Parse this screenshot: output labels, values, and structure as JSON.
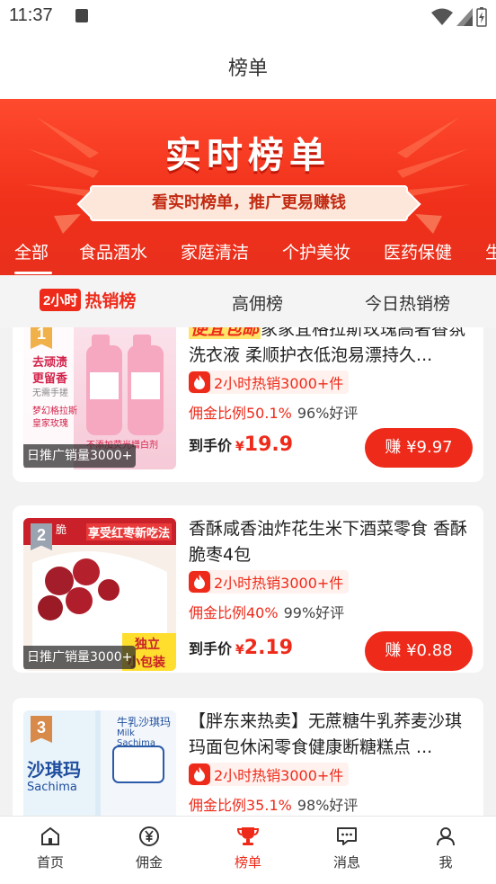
{
  "status_bar": {
    "time": "11:37"
  },
  "header": {
    "title": "榜单"
  },
  "banner": {
    "title": "实时榜单",
    "subtitle": "看实时榜单，推广更易赚钱"
  },
  "category_tabs": [
    "全部",
    "食品酒水",
    "家庭清洁",
    "个护美妆",
    "医药保健",
    "生"
  ],
  "rank_tabs": {
    "active_badge": "2小时",
    "active_label": "热销榜",
    "tab2": "高佣榜",
    "tab3": "今日热销榜"
  },
  "products": [
    {
      "rank": "1",
      "promo": "便宜包邮",
      "title": "家家宜格拉斯玫瑰高奢香氛洗衣液 柔顺护衣低泡易漂持久...",
      "hot": "2小时热销3000+件",
      "commission": "佣金比例50.1%",
      "good_rate": "96%好评",
      "price_label": "到手价",
      "yen": "¥",
      "price": "19.9",
      "earn": "赚 ¥9.97",
      "daily_sales": "日推广销量3000+",
      "thumb_text": [
        "去顽渍",
        "更留香",
        "无需手搓",
        "梦幻格拉斯",
        "皇家玫瑰",
        "不添加荧光增白剂"
      ]
    },
    {
      "rank": "2",
      "promo": "",
      "title": "香酥咸香油炸花生米下酒菜零食 香酥脆枣4包",
      "hot": "2小时热销3000+件",
      "commission": "佣金比例40%",
      "good_rate": "99%好评",
      "price_label": "到手价",
      "yen": "¥",
      "price": "2.19",
      "earn": "赚 ¥0.88",
      "daily_sales": "日推广销量3000+",
      "thumb_text": [
        "享受红枣新吃法",
        "独立",
        "小包装",
        "脆"
      ]
    },
    {
      "rank": "3",
      "promo": "",
      "title": "【胖东来热卖】无蔗糖牛乳荞麦沙琪玛面包休闲零食健康断糖糕点 ...",
      "hot": "2小时热销3000+件",
      "commission": "佣金比例35.1%",
      "good_rate": "98%好评",
      "price_label": "",
      "yen": "",
      "price": "",
      "earn": "",
      "daily_sales": "",
      "thumb_text": [
        "沙琪玛",
        "Sachima",
        "牛乳沙琪玛",
        "Milk Sachima"
      ]
    }
  ],
  "bottom_nav": [
    "首页",
    "佣金",
    "榜单",
    "消息",
    "我"
  ],
  "colors": {
    "accent": "#ee2a1a",
    "banner": "#f0301a",
    "rank_flag": "#f1b14a"
  }
}
